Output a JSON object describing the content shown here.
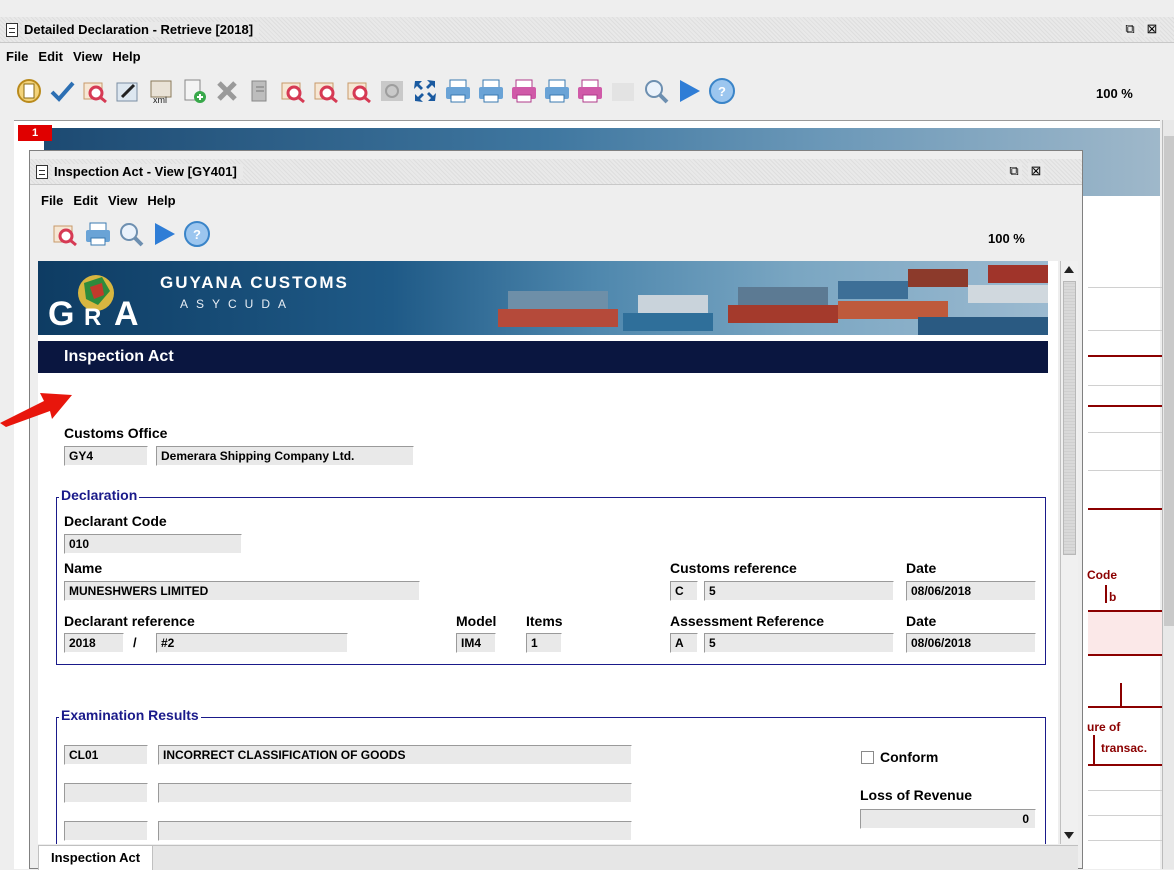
{
  "outer_window": {
    "title": "Detailed Declaration - Retrieve [2018]",
    "menu": [
      "File",
      "Edit",
      "View",
      "Help"
    ],
    "zoom": "100 %",
    "page_number": "1",
    "background_texts": {
      "code": "Code",
      "b": "b",
      "ure_of": "ure of",
      "transac": "transac."
    },
    "toolbar_icons": [
      "new-icon",
      "validate-icon",
      "find-icon",
      "edit-icon",
      "export-xml-icon",
      "add-document-icon",
      "delete-icon",
      "attach-icon",
      "view-icon",
      "view-2-icon",
      "view-3-icon",
      "view-disabled-icon",
      "expand-icon",
      "print-icon",
      "print-2-icon",
      "print-pink-icon",
      "print-3-icon",
      "print-pink-2-icon",
      "blank-icon",
      "zoom-icon",
      "play-icon",
      "help-icon"
    ]
  },
  "inner_window": {
    "title": "Inspection Act - View [GY401]",
    "menu": [
      "File",
      "Edit",
      "View",
      "Help"
    ],
    "zoom": "100 %",
    "toolbar_icons": [
      "find-icon",
      "print-icon",
      "zoom-icon",
      "play-icon",
      "help-icon"
    ],
    "bottom_tab": "Inspection Act"
  },
  "banner": {
    "line1": "GUYANA CUSTOMS",
    "line2": "ASYCUDA",
    "logo_text": "GRA"
  },
  "form": {
    "section_title": "Inspection Act",
    "customs_office": {
      "label": "Customs Office",
      "code": "GY4",
      "name": "Demerara Shipping Company Ltd."
    },
    "declaration": {
      "group_label": "Declaration",
      "declarant_code_label": "Declarant Code",
      "declarant_code": "010",
      "name_label": "Name",
      "name": "MUNESHWERS LIMITED",
      "customs_reference_label": "Customs reference",
      "customs_reference_prefix": "C",
      "customs_reference_value": "5",
      "date_label": "Date",
      "customs_reference_date": "08/06/2018",
      "declarant_reference_label": "Declarant reference",
      "declarant_reference_year": "2018",
      "declarant_reference_sep": "/",
      "declarant_reference_number": "#2",
      "model_label": "Model",
      "model": "IM4",
      "items_label": "Items",
      "items": "1",
      "assessment_reference_label": "Assessment Reference",
      "assessment_reference_prefix": "A",
      "assessment_reference_value": "5",
      "assessment_date_label": "Date",
      "assessment_date": "08/06/2018"
    },
    "examination": {
      "group_label": "Examination Results",
      "rows": [
        {
          "code": "CL01",
          "description": "INCORRECT CLASSIFICATION OF GOODS"
        },
        {
          "code": "",
          "description": ""
        },
        {
          "code": "",
          "description": ""
        }
      ],
      "conform_label": "Conform",
      "loss_of_revenue_label": "Loss of Revenue",
      "loss_of_revenue": "0"
    }
  },
  "colors": {
    "section_header": "#0a1640",
    "group_label": "#1a1a8a",
    "annotation_arrow": "#e8160c",
    "page_tab": "#e00000"
  }
}
